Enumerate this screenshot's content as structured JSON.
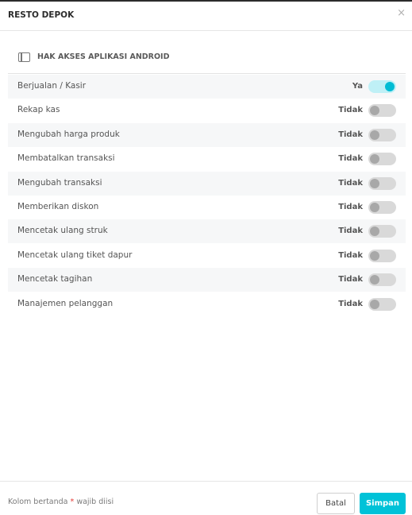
{
  "modal": {
    "title": "RESTO DEPOK",
    "close_label": "×"
  },
  "section": {
    "title": "HAK AKSES APLIKASI ANDROID",
    "icon": "tablet-icon"
  },
  "permissions": [
    {
      "label": "Berjualan / Kasir",
      "value": "Ya",
      "enabled": true
    },
    {
      "label": "Rekap kas",
      "value": "Tidak",
      "enabled": false
    },
    {
      "label": "Mengubah harga produk",
      "value": "Tidak",
      "enabled": false
    },
    {
      "label": "Membatalkan transaksi",
      "value": "Tidak",
      "enabled": false
    },
    {
      "label": "Mengubah transaksi",
      "value": "Tidak",
      "enabled": false
    },
    {
      "label": "Memberikan diskon",
      "value": "Tidak",
      "enabled": false
    },
    {
      "label": "Mencetak ulang struk",
      "value": "Tidak",
      "enabled": false
    },
    {
      "label": "Mencetak ulang tiket dapur",
      "value": "Tidak",
      "enabled": false
    },
    {
      "label": "Mencetak tagihan",
      "value": "Tidak",
      "enabled": false
    },
    {
      "label": "Manajemen pelanggan",
      "value": "Tidak",
      "enabled": false
    }
  ],
  "footer": {
    "note_prefix": "Kolom bertanda",
    "required_mark": "*",
    "note_suffix": "wajib diisi",
    "cancel_label": "Batal",
    "save_label": "Simpan"
  },
  "colors": {
    "accent": "#00c2d8",
    "toggle_on_track": "#bff0f6",
    "required": "#e53935"
  }
}
